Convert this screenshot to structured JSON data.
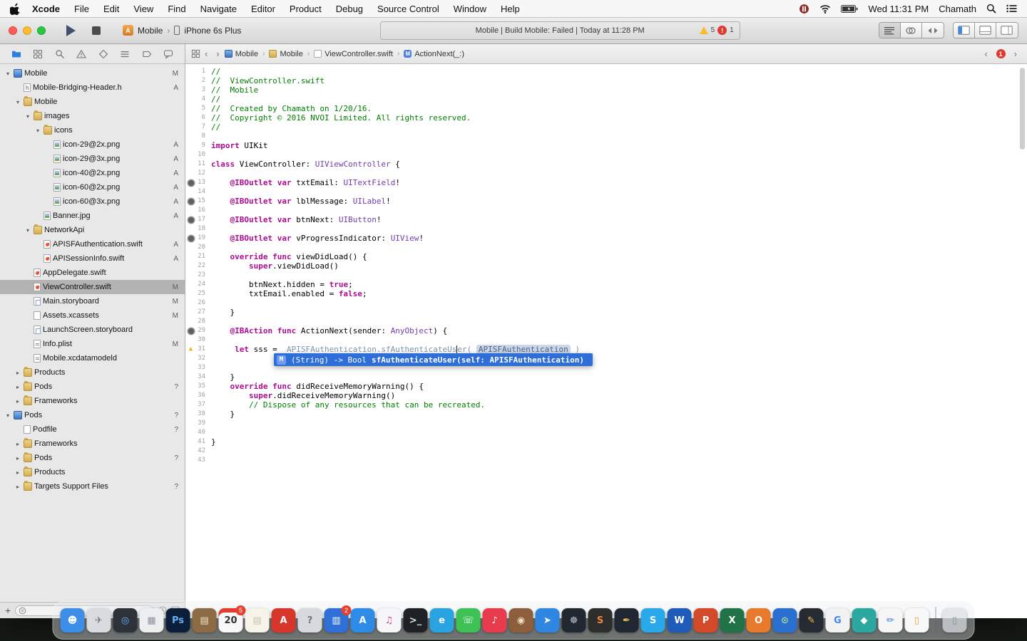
{
  "menu_bar": {
    "app_name": "Xcode",
    "items": [
      "File",
      "Edit",
      "View",
      "Find",
      "Navigate",
      "Editor",
      "Product",
      "Debug",
      "Source Control",
      "Window",
      "Help"
    ],
    "clock": "Wed 11:31 PM",
    "user": "Chamath"
  },
  "toolbar": {
    "scheme_name": "Mobile",
    "device_name": "iPhone 6s Plus",
    "status_text": "Mobile  |  Build Mobile: Failed  |  Today at 11:28 PM",
    "warning_count": "5",
    "error_count": "1"
  },
  "jump_bar": {
    "crumbs": [
      {
        "icon": "project",
        "label": "Mobile"
      },
      {
        "icon": "folder",
        "label": "Mobile"
      },
      {
        "icon": "swift-file",
        "label": "ViewController.swift"
      },
      {
        "icon": "method",
        "label": "ActionNext(_:)"
      }
    ],
    "issue_count": "1"
  },
  "sidebar": {
    "rows": [
      {
        "depth": 0,
        "icon": "project",
        "label": "Mobile",
        "badge": "M",
        "disc": "open"
      },
      {
        "depth": 1,
        "icon": "header-file",
        "label": "Mobile-Bridging-Header.h",
        "badge": "A"
      },
      {
        "depth": 1,
        "icon": "folder",
        "label": "Mobile",
        "disc": "open"
      },
      {
        "depth": 2,
        "icon": "folder",
        "label": "images",
        "disc": "open"
      },
      {
        "depth": 3,
        "icon": "folder",
        "label": "icons",
        "disc": "open"
      },
      {
        "depth": 4,
        "icon": "image-file",
        "label": "icon-29@2x.png",
        "badge": "A"
      },
      {
        "depth": 4,
        "icon": "image-file",
        "label": "icon-29@3x.png",
        "badge": "A"
      },
      {
        "depth": 4,
        "icon": "image-file",
        "label": "icon-40@2x.png",
        "badge": "A"
      },
      {
        "depth": 4,
        "icon": "image-file",
        "label": "icon-60@2x.png",
        "badge": "A"
      },
      {
        "depth": 4,
        "icon": "image-file",
        "label": "icon-60@3x.png",
        "badge": "A"
      },
      {
        "depth": 3,
        "icon": "image-file",
        "label": "Banner.jpg",
        "badge": "A"
      },
      {
        "depth": 2,
        "icon": "folder",
        "label": "NetworkApi",
        "disc": "open"
      },
      {
        "depth": 3,
        "icon": "swift-file",
        "label": "APISFAuthentication.swift",
        "badge": "A"
      },
      {
        "depth": 3,
        "icon": "swift-file",
        "label": "APISessionInfo.swift",
        "badge": "A"
      },
      {
        "depth": 2,
        "icon": "swift-file",
        "label": "AppDelegate.swift"
      },
      {
        "depth": 2,
        "icon": "swift-file",
        "label": "ViewController.swift",
        "badge": "M",
        "selected": true
      },
      {
        "depth": 2,
        "icon": "storyboard-file",
        "label": "Main.storyboard",
        "badge": "M"
      },
      {
        "depth": 2,
        "icon": "xcassets-file",
        "label": "Assets.xcassets",
        "badge": "M"
      },
      {
        "depth": 2,
        "icon": "storyboard-file",
        "label": "LaunchScreen.storyboard"
      },
      {
        "depth": 2,
        "icon": "plist-file",
        "label": "Info.plist",
        "badge": "M"
      },
      {
        "depth": 2,
        "icon": "datamodel-file",
        "label": "Mobile.xcdatamodeld"
      },
      {
        "depth": 1,
        "icon": "folder",
        "label": "Products",
        "disc": "closed"
      },
      {
        "depth": 1,
        "icon": "folder",
        "label": "Pods",
        "badge": "?",
        "disc": "closed"
      },
      {
        "depth": 1,
        "icon": "folder",
        "label": "Frameworks",
        "disc": "closed"
      },
      {
        "depth": 0,
        "icon": "project",
        "label": "Pods",
        "badge": "?",
        "disc": "open"
      },
      {
        "depth": 1,
        "icon": "plain-file",
        "label": "Podfile",
        "badge": "?"
      },
      {
        "depth": 1,
        "icon": "folder",
        "label": "Frameworks",
        "disc": "closed"
      },
      {
        "depth": 1,
        "icon": "folder",
        "label": "Pods",
        "badge": "?",
        "disc": "closed"
      },
      {
        "depth": 1,
        "icon": "folder",
        "label": "Products",
        "disc": "closed"
      },
      {
        "depth": 1,
        "icon": "folder",
        "label": "Targets Support Files",
        "badge": "?",
        "disc": "closed"
      }
    ]
  },
  "editor": {
    "popup": {
      "kind": "M",
      "signature": "(String) -> Bool",
      "completion": "sfAuthenticateUser(self: APISFAuthentication)"
    },
    "lines": [
      {
        "n": 1,
        "s": [
          [
            "cm",
            "//"
          ]
        ]
      },
      {
        "n": 2,
        "s": [
          [
            "cm",
            "//  ViewController.swift"
          ]
        ]
      },
      {
        "n": 3,
        "s": [
          [
            "cm",
            "//  Mobile"
          ]
        ]
      },
      {
        "n": 4,
        "s": [
          [
            "cm",
            "//"
          ]
        ]
      },
      {
        "n": 5,
        "s": [
          [
            "cm",
            "//  Created by Chamath on 1/20/16."
          ]
        ]
      },
      {
        "n": 6,
        "s": [
          [
            "cm",
            "//  Copyright © 2016 NVOI Limited. All rights reserved."
          ]
        ]
      },
      {
        "n": 7,
        "s": [
          [
            "cm",
            "//"
          ]
        ]
      },
      {
        "n": 8,
        "s": []
      },
      {
        "n": 9,
        "s": [
          [
            "kw",
            "import"
          ],
          [
            "pl",
            " UIKit"
          ]
        ]
      },
      {
        "n": 10,
        "s": []
      },
      {
        "n": 11,
        "s": [
          [
            "kw",
            "class"
          ],
          [
            "pl",
            " ViewController: "
          ],
          [
            "ty",
            "UIViewController"
          ],
          [
            "pl",
            " {"
          ]
        ]
      },
      {
        "n": 12,
        "s": []
      },
      {
        "n": 13,
        "m": "well",
        "s": [
          [
            "pl",
            "    "
          ],
          [
            "kw",
            "@IBOutlet"
          ],
          [
            "pl",
            " "
          ],
          [
            "kw",
            "var"
          ],
          [
            "pl",
            " txtEmail: "
          ],
          [
            "ty",
            "UITextField"
          ],
          [
            "pl",
            "!"
          ]
        ]
      },
      {
        "n": 14,
        "s": []
      },
      {
        "n": 15,
        "m": "well",
        "s": [
          [
            "pl",
            "    "
          ],
          [
            "kw",
            "@IBOutlet"
          ],
          [
            "pl",
            " "
          ],
          [
            "kw",
            "var"
          ],
          [
            "pl",
            " lblMessage: "
          ],
          [
            "ty",
            "UILabel"
          ],
          [
            "pl",
            "!"
          ]
        ]
      },
      {
        "n": 16,
        "s": []
      },
      {
        "n": 17,
        "m": "well",
        "s": [
          [
            "pl",
            "    "
          ],
          [
            "kw",
            "@IBOutlet"
          ],
          [
            "pl",
            " "
          ],
          [
            "kw",
            "var"
          ],
          [
            "pl",
            " btnNext: "
          ],
          [
            "ty",
            "UIButton"
          ],
          [
            "pl",
            "!"
          ]
        ]
      },
      {
        "n": 18,
        "s": []
      },
      {
        "n": 19,
        "m": "well",
        "s": [
          [
            "pl",
            "    "
          ],
          [
            "kw",
            "@IBOutlet"
          ],
          [
            "pl",
            " "
          ],
          [
            "kw",
            "var"
          ],
          [
            "pl",
            " vProgressIndicator: "
          ],
          [
            "ty",
            "UIView"
          ],
          [
            "pl",
            "!"
          ]
        ]
      },
      {
        "n": 20,
        "s": []
      },
      {
        "n": 21,
        "s": [
          [
            "pl",
            "    "
          ],
          [
            "kw",
            "override"
          ],
          [
            "pl",
            " "
          ],
          [
            "kw",
            "func"
          ],
          [
            "pl",
            " viewDidLoad() {"
          ]
        ]
      },
      {
        "n": 22,
        "s": [
          [
            "pl",
            "        "
          ],
          [
            "kw",
            "super"
          ],
          [
            "pl",
            ".viewDidLoad()"
          ]
        ]
      },
      {
        "n": 23,
        "s": []
      },
      {
        "n": 24,
        "s": [
          [
            "pl",
            "        btnNext.hidden = "
          ],
          [
            "kw",
            "true"
          ],
          [
            "pl",
            ";"
          ]
        ]
      },
      {
        "n": 25,
        "s": [
          [
            "pl",
            "        txtEmail.enabled = "
          ],
          [
            "kw",
            "false"
          ],
          [
            "pl",
            ";"
          ]
        ]
      },
      {
        "n": 26,
        "s": []
      },
      {
        "n": 27,
        "s": [
          [
            "pl",
            "    }"
          ]
        ]
      },
      {
        "n": 28,
        "s": []
      },
      {
        "n": 29,
        "m": "well",
        "s": [
          [
            "pl",
            "    "
          ],
          [
            "kw",
            "@IBAction"
          ],
          [
            "pl",
            " "
          ],
          [
            "kw",
            "func"
          ],
          [
            "pl",
            " ActionNext(sender: "
          ],
          [
            "ty",
            "AnyObject"
          ],
          [
            "pl",
            ") {"
          ]
        ]
      },
      {
        "n": 30,
        "s": []
      },
      {
        "n": 31,
        "m": "warn",
        "s": [
          [
            "pl",
            "     "
          ],
          [
            "kw",
            "let"
          ],
          [
            "pl",
            " sss =  "
          ],
          [
            "pe",
            "APISFAuthentication.sfAuthenticateUs"
          ],
          [
            "cu",
            ""
          ],
          [
            "pe",
            "er( "
          ],
          [
            "ph",
            "APISFAuthentication"
          ],
          [
            "pe",
            " )"
          ]
        ]
      },
      {
        "n": 32,
        "s": []
      },
      {
        "n": 33,
        "s": []
      },
      {
        "n": 34,
        "s": [
          [
            "pl",
            "    }"
          ]
        ]
      },
      {
        "n": 35,
        "s": [
          [
            "pl",
            "    "
          ],
          [
            "kw",
            "override"
          ],
          [
            "pl",
            " "
          ],
          [
            "kw",
            "func"
          ],
          [
            "pl",
            " didReceiveMemoryWarning() {"
          ]
        ]
      },
      {
        "n": 36,
        "s": [
          [
            "pl",
            "        "
          ],
          [
            "kw",
            "super"
          ],
          [
            "pl",
            ".didReceiveMemoryWarning()"
          ]
        ]
      },
      {
        "n": 37,
        "s": [
          [
            "cm",
            "        // Dispose of any resources that can be recreated."
          ]
        ]
      },
      {
        "n": 38,
        "s": [
          [
            "pl",
            "    }"
          ]
        ]
      },
      {
        "n": 39,
        "s": []
      },
      {
        "n": 40,
        "s": []
      },
      {
        "n": 41,
        "s": [
          [
            "pl",
            "}"
          ]
        ]
      },
      {
        "n": 42,
        "s": []
      },
      {
        "n": 43,
        "s": []
      }
    ]
  },
  "dock": {
    "apps": [
      {
        "name": "finder",
        "glyph": "☻",
        "bg": "#3d8ee6",
        "fg": "#ffffff"
      },
      {
        "name": "launchpad",
        "glyph": "✈",
        "bg": "#d9dbdf",
        "fg": "#737a84"
      },
      {
        "name": "photos",
        "glyph": "◎",
        "bg": "#2c313a",
        "fg": "#6fb1ff"
      },
      {
        "name": "mission-control",
        "glyph": "▦",
        "bg": "#eceef0",
        "fg": "#8b939e"
      },
      {
        "name": "photoshop",
        "glyph": "Ps",
        "bg": "#0c1f3a",
        "fg": "#64aef0"
      },
      {
        "name": "library",
        "glyph": "▤",
        "bg": "#8d6b44",
        "fg": "#f2e4c8"
      },
      {
        "name": "calendar",
        "glyph": "20",
        "bg": "#f8f8f8",
        "fg": "#333333",
        "badge": "5",
        "accent": "#e03c32"
      },
      {
        "name": "notes",
        "glyph": "▤",
        "bg": "#f6f3e9",
        "fg": "#c9c2ae"
      },
      {
        "name": "red-app",
        "glyph": "A",
        "bg": "#d9362b",
        "fg": "#ffffff"
      },
      {
        "name": "help",
        "glyph": "?",
        "bg": "#d6d9dd",
        "fg": "#6e757f"
      },
      {
        "name": "dictionary",
        "glyph": "▥",
        "bg": "#2f6fd8",
        "fg": "#ffffff",
        "badge": "2"
      },
      {
        "name": "app-store",
        "glyph": "A",
        "bg": "#2e8ce8",
        "fg": "#ffffff"
      },
      {
        "name": "itunes",
        "glyph": "♫",
        "bg": "#f6f6f8",
        "fg": "#d84a8b"
      },
      {
        "name": "terminal",
        "glyph": ">_",
        "bg": "#1e2126",
        "fg": "#d3e6d3"
      },
      {
        "name": "browser",
        "glyph": "e",
        "bg": "#2aa3e1",
        "fg": "#ffffff"
      },
      {
        "name": "facetime",
        "glyph": "☏",
        "bg": "#3fc156",
        "fg": "#ffffff"
      },
      {
        "name": "music",
        "glyph": "♪",
        "bg": "#e83c4e",
        "fg": "#ffffff"
      },
      {
        "name": "podcasts",
        "glyph": "◉",
        "bg": "#8d5e3c",
        "fg": "#f4dfc0"
      },
      {
        "name": "safari",
        "glyph": "➤",
        "bg": "#3087e2",
        "fg": "#ffffff"
      },
      {
        "name": "helm",
        "glyph": "☸",
        "bg": "#222831",
        "fg": "#b9c6d4"
      },
      {
        "name": "sublime-text",
        "glyph": "S",
        "bg": "#2d2d2d",
        "fg": "#ef8733"
      },
      {
        "name": "sketch",
        "glyph": "✒",
        "bg": "#212633",
        "fg": "#f2c14e"
      },
      {
        "name": "skype",
        "glyph": "S",
        "bg": "#29a9ea",
        "fg": "#ffffff"
      },
      {
        "name": "word",
        "glyph": "W",
        "bg": "#1f5cb9",
        "fg": "#ffffff"
      },
      {
        "name": "powerpoint",
        "glyph": "P",
        "bg": "#d3492a",
        "fg": "#ffffff"
      },
      {
        "name": "excel",
        "glyph": "X",
        "bg": "#207347",
        "fg": "#ffffff"
      },
      {
        "name": "firefox",
        "glyph": "O",
        "bg": "#e87a2d",
        "fg": "#ffffff"
      },
      {
        "name": "earth",
        "glyph": "⊙",
        "bg": "#2b70d1",
        "fg": "#aade8e"
      },
      {
        "name": "pen",
        "glyph": "✎",
        "bg": "#262b33",
        "fg": "#f2c14e"
      },
      {
        "name": "chrome",
        "glyph": "G",
        "bg": "#f2f2f2",
        "fg": "#4285f4"
      },
      {
        "name": "teal-app",
        "glyph": "◆",
        "bg": "#2ba9a1",
        "fg": "#ffffff"
      },
      {
        "name": "draw",
        "glyph": "✏",
        "bg": "#f6f6f6",
        "fg": "#3a7bd5"
      },
      {
        "name": "pages",
        "glyph": "▯",
        "bg": "#f8f8f8",
        "fg": "#e8a33a"
      },
      {
        "name": "trash",
        "glyph": "▯",
        "bg": "rgba(220,224,228,0.7)",
        "fg": "#8a9098",
        "separator": true
      }
    ]
  }
}
